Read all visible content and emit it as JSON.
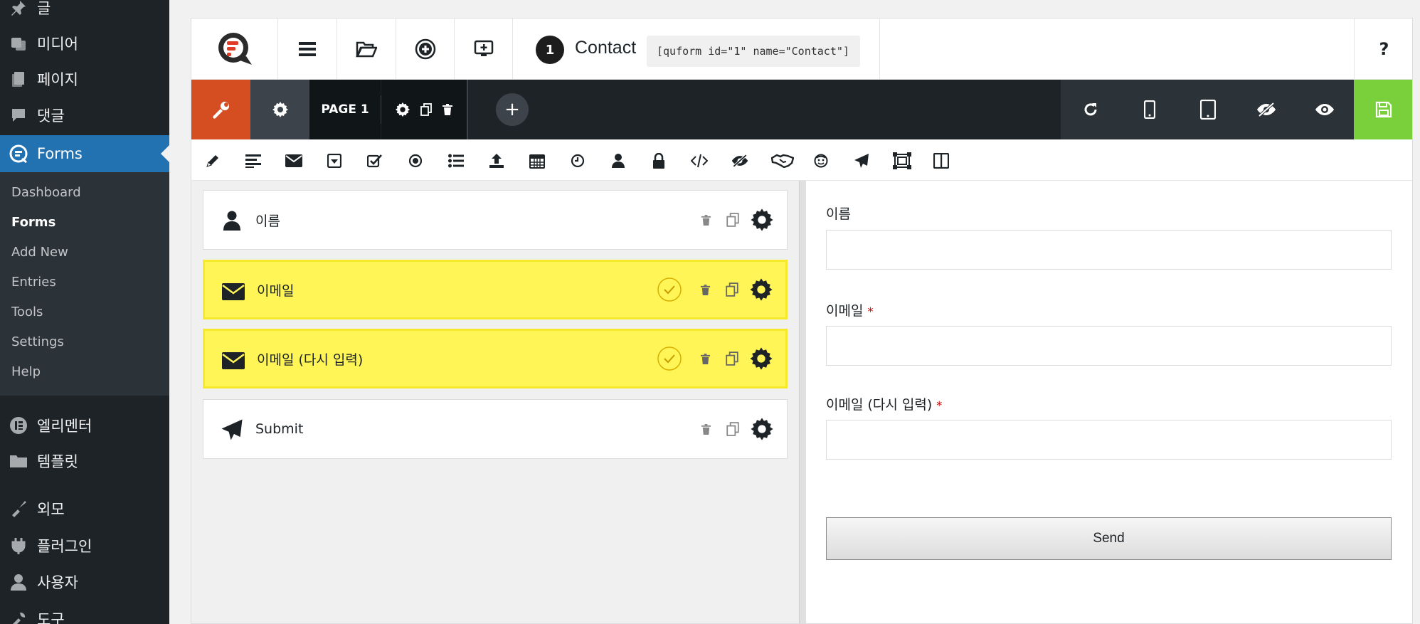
{
  "sidebar": {
    "items": [
      {
        "label": "글",
        "icon": "pin-icon"
      },
      {
        "label": "미디어",
        "icon": "media-icon"
      },
      {
        "label": "페이지",
        "icon": "pages-icon"
      },
      {
        "label": "댓글",
        "icon": "comments-icon"
      },
      {
        "label": "Forms",
        "icon": "quform-icon"
      },
      {
        "label": "엘리멘터",
        "icon": "elementor-icon"
      },
      {
        "label": "템플릿",
        "icon": "folder-icon"
      },
      {
        "label": "외모",
        "icon": "appearance-icon"
      },
      {
        "label": "플러그인",
        "icon": "plugins-icon"
      },
      {
        "label": "사용자",
        "icon": "users-icon"
      },
      {
        "label": "도구",
        "icon": "tools-icon"
      }
    ],
    "submenu": [
      "Dashboard",
      "Forms",
      "Add New",
      "Entries",
      "Tools",
      "Settings",
      "Help"
    ]
  },
  "topbar": {
    "form_number": "1",
    "form_name": "Contact",
    "shortcode": "[quform id=\"1\" name=\"Contact\"]",
    "help": "?"
  },
  "darkbar": {
    "page_label": "PAGE 1",
    "add": "+",
    "accent_red": "#d54e21",
    "accent_green": "#7ad03a"
  },
  "fields": [
    {
      "label": "이름",
      "icon": "user-icon",
      "highlighted": false
    },
    {
      "label": "이메일",
      "icon": "envelope-icon",
      "highlighted": true
    },
    {
      "label": "이메일 (다시 입력)",
      "icon": "envelope-icon",
      "highlighted": true
    },
    {
      "label": "Submit",
      "icon": "paper-plane-icon",
      "highlighted": false
    }
  ],
  "preview": {
    "fields": [
      {
        "label": "이름",
        "required": false
      },
      {
        "label": "이메일",
        "required": true,
        "required_mark": "*"
      },
      {
        "label": "이메일 (다시 입력)",
        "required": true,
        "required_mark": "*"
      }
    ],
    "submit_label": "Send"
  }
}
